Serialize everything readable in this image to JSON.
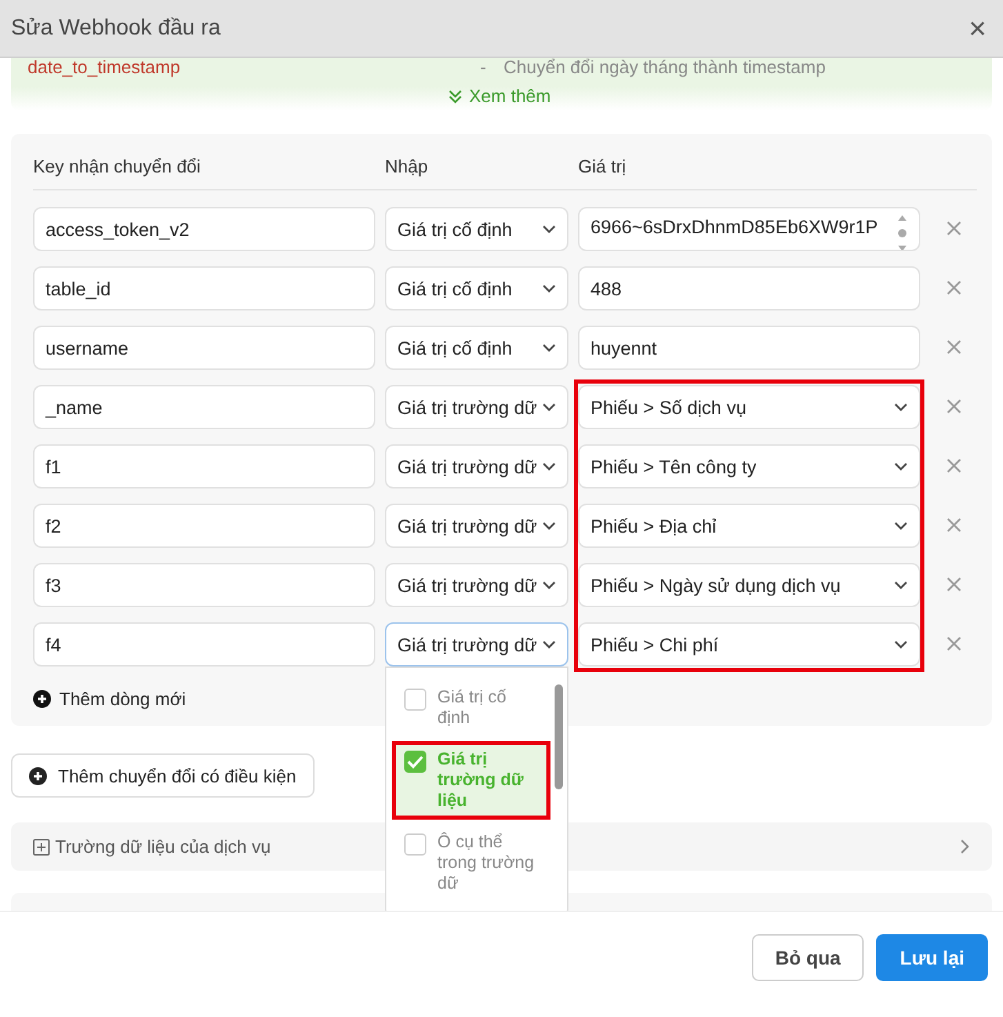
{
  "dialog": {
    "title": "Sửa Webhook đầu ra",
    "close_icon": "×"
  },
  "functions_hint": {
    "name": "date_to_timestamp",
    "separator": "-",
    "description": "Chuyển đổi ngày tháng thành timestamp",
    "more_link": "Xem thêm"
  },
  "mapping": {
    "columns": [
      "Key nhận chuyển đổi",
      "Nhập",
      "Giá trị"
    ],
    "rows": [
      {
        "key": "access_token_v2",
        "mode": "Giá trị cố định",
        "kind": "textarea",
        "value": "6966~6sDrxDhnmD85Eb6XW9r1P",
        "marked": false,
        "dropdown_open": false
      },
      {
        "key": "table_id",
        "mode": "Giá trị cố định",
        "kind": "text",
        "value": "488",
        "marked": false,
        "dropdown_open": false
      },
      {
        "key": "username",
        "mode": "Giá trị cố định",
        "kind": "text",
        "value": "huyennt",
        "marked": false,
        "dropdown_open": false
      },
      {
        "key": "_name",
        "mode": "Giá trị trường dữ",
        "kind": "select",
        "value": "Phiếu > Số dịch vụ",
        "marked": true,
        "dropdown_open": false
      },
      {
        "key": "f1",
        "mode": "Giá trị trường dữ",
        "kind": "select",
        "value": "Phiếu > Tên công ty",
        "marked": true,
        "dropdown_open": false
      },
      {
        "key": "f2",
        "mode": "Giá trị trường dữ",
        "kind": "select",
        "value": "Phiếu > Địa chỉ",
        "marked": true,
        "dropdown_open": false
      },
      {
        "key": "f3",
        "mode": "Giá trị trường dữ",
        "kind": "select",
        "value": "Phiếu > Ngày sử dụng dịch vụ",
        "marked": true,
        "dropdown_open": false
      },
      {
        "key": "f4",
        "mode": "Giá trị trường dữ",
        "kind": "select",
        "value": "Phiếu > Chi phí",
        "marked": true,
        "dropdown_open": true
      }
    ],
    "add_row": "Thêm dòng mới"
  },
  "mode_dropdown": {
    "options": [
      {
        "label": "Giá trị cố định",
        "checked": false,
        "marked": false
      },
      {
        "label": "Giá trị trường dữ liệu",
        "checked": true,
        "marked": true
      },
      {
        "label": "Ô cụ thể trong trường dữ",
        "checked": false,
        "marked": false
      }
    ]
  },
  "add_condition_button": "Thêm chuyển đổi có điều kiện",
  "service_fields": {
    "label": "Trường dữ liệu của dịch vụ",
    "expanded": false
  },
  "footer": {
    "buttons": [
      {
        "label": "Bỏ qua",
        "kind": "secondary"
      },
      {
        "label": "Lưu lại",
        "kind": "primary"
      }
    ]
  }
}
